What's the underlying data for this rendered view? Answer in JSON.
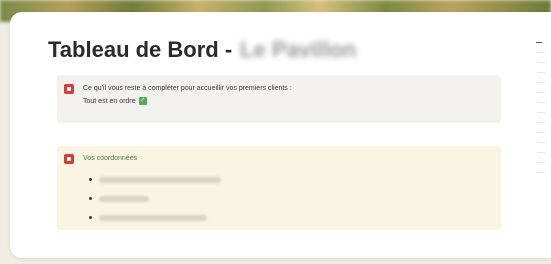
{
  "header": {
    "title": "Tableau de Bord -",
    "venue_name_blurred": "Le Pavillon"
  },
  "alert": {
    "icon": "red-square-icon",
    "line1": "Ce qu'il vous reste à compléter pour accueillir vos premiers clients :",
    "line2": "Tout est en ordre",
    "status_icon": "check-mark-icon",
    "status_color": "#4caf50"
  },
  "coordinates": {
    "icon": "red-square-icon",
    "title": "Vos coordonnées",
    "items": [
      {
        "redacted": true
      },
      {
        "redacted": true
      },
      {
        "redacted": true
      }
    ]
  },
  "colors": {
    "alert_background": "#f3f1ee",
    "coordinates_background": "#faf4e2",
    "accent_red": "#d93a3a",
    "coordinates_title": "#4b7a3a"
  }
}
